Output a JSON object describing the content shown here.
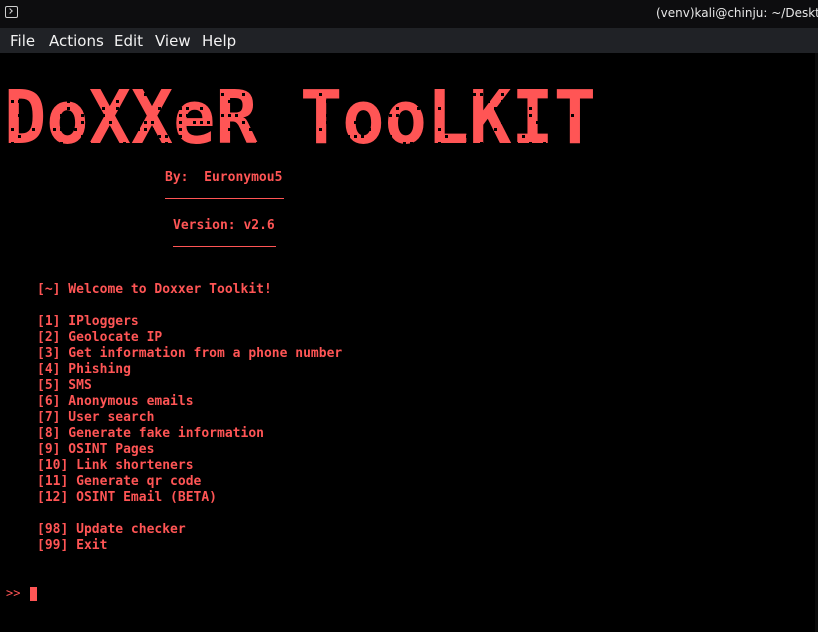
{
  "window": {
    "title": "(venv)kali@chinju: ~/Desktop/",
    "icon": "terminal-icon"
  },
  "menu": [
    "File",
    "Actions",
    "Edit",
    "View",
    "Help"
  ],
  "terminal": {
    "banner_text": "DoXXeR TooLKIT",
    "author": "By:  Euronymou5",
    "version": "Version: v2.6",
    "welcome": "[~] Welcome to Doxxer Toolkit!",
    "options": [
      "[1] IPloggers",
      "[2] Geolocate IP",
      "[3] Get information from a phone number",
      "[4] Phishing",
      "[5] SMS",
      "[6] Anonymous emails",
      "[7] User search",
      "[8] Generate fake information",
      "[9] OSINT Pages",
      "[10] Link shorteners",
      "[11] Generate qr code",
      "[12] OSINT Email (BETA)"
    ],
    "extra_options": [
      "[98] Update checker",
      "[99] Exit"
    ],
    "prompt": ">>",
    "colors": {
      "text": "#ff5555",
      "background": "#000000"
    }
  }
}
